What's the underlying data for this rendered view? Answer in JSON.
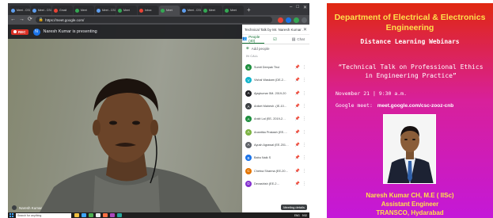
{
  "browser": {
    "tabs": [
      {
        "label": "Meet - CSC",
        "color": "#5f9ff0"
      },
      {
        "label": "Meet - CSC",
        "color": "#5f9ff0"
      },
      {
        "label": "Gmail",
        "color": "#ea4335"
      },
      {
        "label": "Meet",
        "color": "#34a853"
      },
      {
        "label": "Meet - CSC",
        "color": "#5f9ff0"
      },
      {
        "label": "Meet",
        "color": "#34a853"
      },
      {
        "label": "Inbox",
        "color": "#ea4335"
      },
      {
        "label": "Meet",
        "color": "#34a853",
        "active": true
      },
      {
        "label": "Meet - CSC",
        "color": "#5f9ff0"
      },
      {
        "label": "Meet",
        "color": "#34a853"
      },
      {
        "label": "Meet",
        "color": "#34a853"
      }
    ],
    "new_tab_icon": "+",
    "window_controls": [
      "–",
      "□",
      "✕"
    ],
    "url": "https://meet.google.com/",
    "extension_colors": [
      "#ea4335",
      "#1a73e8",
      "#34a853",
      "#5f6368"
    ]
  },
  "meet": {
    "rec_label": "REC",
    "presenter_initial": "N",
    "presenting_text": "Naresh Kumar is presenting",
    "video_person_label": "Naresh Kumar",
    "panel_title": "Technical Talk by Mr. Naresh Kumar …",
    "close_icon": "✕",
    "tabs": {
      "people": "People (40)",
      "chat": "Chat"
    },
    "add_people": "Add people",
    "in_call": "IN CALL",
    "participants": [
      {
        "initial": "S",
        "name": "Sumit Deepak Thul",
        "color": "#1e8e3e"
      },
      {
        "initial": "V",
        "name": "Vishal Waskam (DE-2…",
        "color": "#12b5cb"
      },
      {
        "initial": "A",
        "name": "Ajaykumar 5M- 2019-20",
        "color": "#202124"
      },
      {
        "initial": "A",
        "name": "Aniket Mahesh -(IE-10…",
        "color": "#3c4043"
      },
      {
        "initial": "A",
        "name": "Ankit Lal (EE- 2019-2…",
        "color": "#1e8e3e"
      },
      {
        "initial": "A",
        "name": "Anantika Prakash (EE-…",
        "color": "#7cb342"
      },
      {
        "initial": "A",
        "name": "Ayush Agrawal (EE-201…",
        "color": "#5f6368"
      },
      {
        "initial": "B",
        "name": "Babu Naik S",
        "color": "#1a73e8"
      },
      {
        "initial": "C",
        "name": "Chetna Sharma (EE-20…",
        "color": "#e37400"
      },
      {
        "initial": "D",
        "name": "Devashish (EE-2…",
        "color": "#8430ce"
      }
    ],
    "cta_label": "Meeting details"
  },
  "taskbar": {
    "search_placeholder": "Search for anything",
    "app_colors": [
      "#f0c040",
      "#3ea6ff",
      "#4caf50",
      "#e8eaed",
      "#ff7043",
      "#ab47bc",
      "#26a69a"
    ],
    "tray_language": "ENG",
    "tray_time": "9:52"
  },
  "poster": {
    "department": "Department of Electrical & Electronics Engineering",
    "series": "Distance Learning Webinars",
    "talk_title": "“Technical Talk on Professional Ethics in Engineering Practice”",
    "date_time": "November 21 | 9:30 a.m.",
    "meet_label": "Google meet:",
    "meet_link": "meet.google.com/csc-zooz-cnb",
    "speaker_name": "Naresh Kumar CH, M.E ( IISc)",
    "speaker_role": "Assistant Engineer",
    "speaker_org": "TRANSCO, Hydarabad",
    "colors": {
      "heading": "#ffe14a",
      "text": "#ffffff"
    }
  }
}
